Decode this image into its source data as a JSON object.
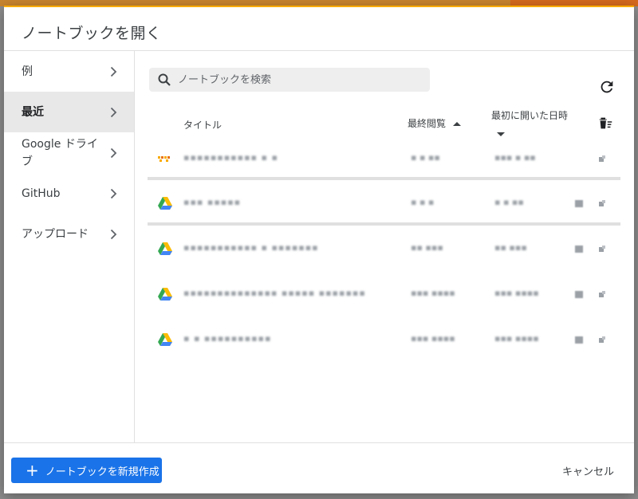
{
  "dialog": {
    "title": "ノートブックを開く"
  },
  "nav": {
    "items": [
      {
        "label": "例",
        "active": false
      },
      {
        "label": "最近",
        "active": true
      },
      {
        "label": "Google ドライブ",
        "active": false
      },
      {
        "label": "GitHub",
        "active": false
      },
      {
        "label": "アップロード",
        "active": false
      }
    ]
  },
  "search": {
    "placeholder": "ノートブックを検索"
  },
  "table": {
    "col_title": "タイトル",
    "col_last_viewed": "最終閲覧",
    "col_first_opened": "最初に開いた日時"
  },
  "footer": {
    "new_notebook_label": "ノートブックを新規作成",
    "cancel_label": "キャンセル"
  },
  "colors": {
    "accent": "#1a73e8",
    "dialog_top_border": "#f9ab00",
    "active_nav": "#e8e8e8"
  },
  "icons": {
    "row_first": "colab-logo-icon",
    "row_other": "google-drive-icon",
    "search": "search-icon",
    "refresh": "refresh-icon",
    "trash": "trash-filter-icon",
    "chevron": "chevron-right-icon"
  }
}
